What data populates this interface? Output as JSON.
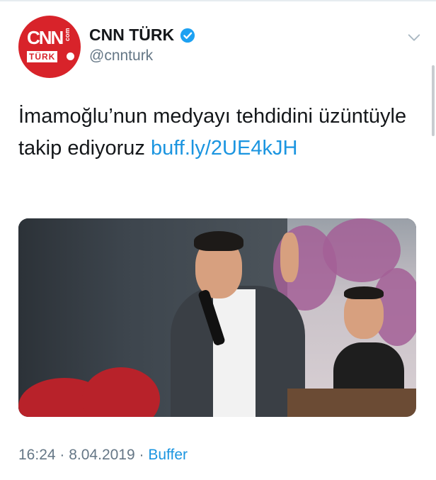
{
  "account": {
    "display_name": "CNN TÜRK",
    "handle": "@cnnturk",
    "verified": true,
    "avatar_logo_text": "CNN",
    "avatar_logo_sub": "TÜRK",
    "avatar_logo_side": "com"
  },
  "tweet": {
    "text": "İmamoğlu’nun medyayı tehdidini üzüntüyle takip ediyoruz ",
    "link": "buff.ly/2UE4kJH"
  },
  "meta": {
    "time": "16:24",
    "separator": " · ",
    "date": "8.04.2019",
    "source": "Buffer"
  },
  "icons": {
    "verified": "verified-badge-icon",
    "menu": "chevron-down-icon"
  },
  "colors": {
    "brand_red": "#d8232a",
    "link_blue": "#1b95e0",
    "muted_gray": "#657786",
    "verified_blue": "#1da1f2"
  }
}
